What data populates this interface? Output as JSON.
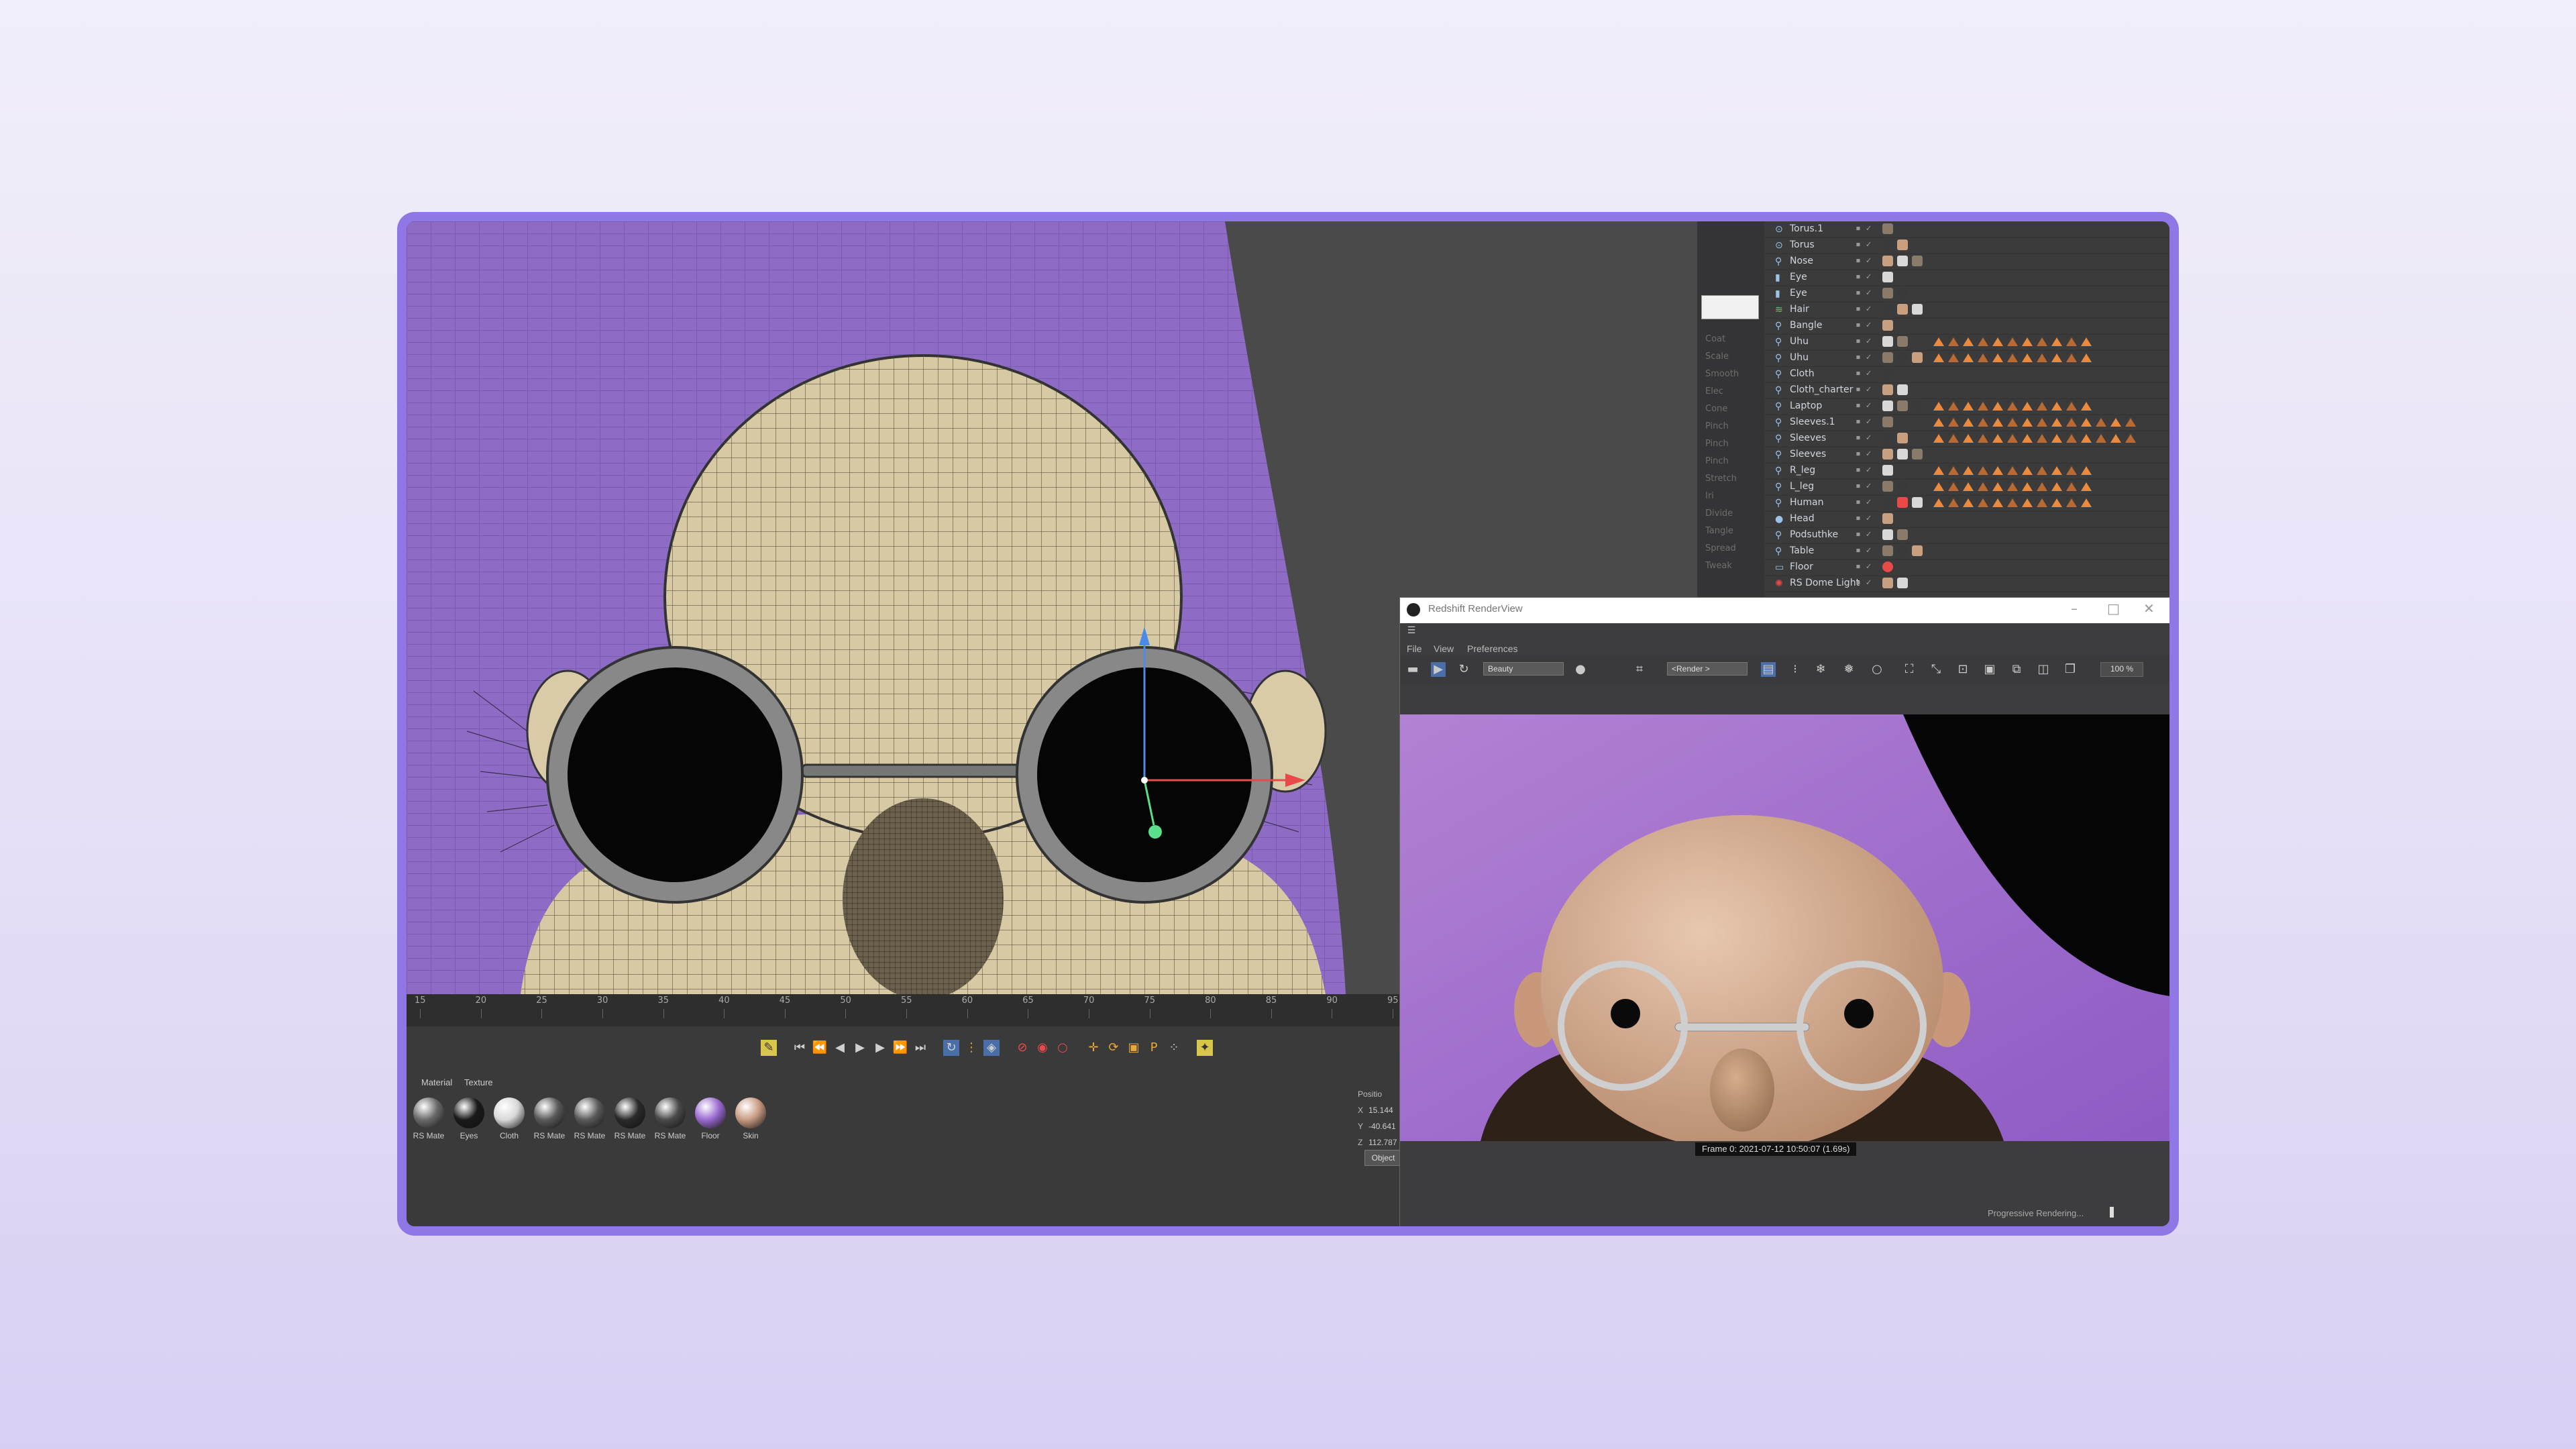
{
  "render_view": {
    "title": "Redshift RenderView",
    "menus": [
      "File",
      "View",
      "Preferences"
    ],
    "aov_select": "Beauty",
    "camera_select": "<Render >",
    "zoom": "100 %",
    "frame_info": "Frame  0:  2021-07-12  10:50:07  (1.69s)",
    "progress_label": "Progressive Rendering..."
  },
  "objects": [
    {
      "name": "Torus.1",
      "icon": "torus"
    },
    {
      "name": "Torus",
      "icon": "torus"
    },
    {
      "name": "Nose",
      "icon": "figure"
    },
    {
      "name": "Eye",
      "icon": "cylinder"
    },
    {
      "name": "Eye",
      "icon": "cylinder"
    },
    {
      "name": "Hair",
      "icon": "hair"
    },
    {
      "name": "Bangle",
      "icon": "figure"
    },
    {
      "name": "Uhu",
      "icon": "figure"
    },
    {
      "name": "Uhu",
      "icon": "figure"
    },
    {
      "name": "Cloth",
      "icon": "figure"
    },
    {
      "name": "Cloth_charter",
      "icon": "figure"
    },
    {
      "name": "Laptop",
      "icon": "figure"
    },
    {
      "name": "Sleeves.1",
      "icon": "figure"
    },
    {
      "name": "Sleeves",
      "icon": "figure"
    },
    {
      "name": "Sleeves",
      "icon": "figure"
    },
    {
      "name": "R_leg",
      "icon": "figure"
    },
    {
      "name": "L_leg",
      "icon": "figure"
    },
    {
      "name": "Human",
      "icon": "figure"
    },
    {
      "name": "Head",
      "icon": "sphere"
    },
    {
      "name": "Podsuthke",
      "icon": "figure"
    },
    {
      "name": "Table",
      "icon": "figure"
    },
    {
      "name": "Floor",
      "icon": "floor"
    },
    {
      "name": "RS Dome Light",
      "icon": "light"
    }
  ],
  "timeline": {
    "ticks": [
      "15",
      "20",
      "25",
      "30",
      "35",
      "40",
      "45",
      "50",
      "55",
      "60",
      "65",
      "70",
      "75",
      "80",
      "85",
      "90",
      "95"
    ]
  },
  "materials": {
    "tabs": [
      "Material",
      "Texture"
    ],
    "items": [
      {
        "label": "RS Mate",
        "color": "#6a6a6a"
      },
      {
        "label": "Eyes",
        "color": "#1a1a1a"
      },
      {
        "label": "Cloth",
        "color": "#d8d8d8"
      },
      {
        "label": "RS Mate",
        "color": "#5a5a5a"
      },
      {
        "label": "RS Mate",
        "color": "#5a5a5a"
      },
      {
        "label": "RS Mate",
        "color": "#2a2a2a"
      },
      {
        "label": "RS Mate",
        "color": "#4a4a4a"
      },
      {
        "label": "Floor",
        "color": "#9a6ad0"
      },
      {
        "label": "Skin",
        "color": "#c89a82"
      }
    ]
  },
  "coordinates": {
    "header": "Positio",
    "x_label": "X",
    "x_value": "15.144",
    "y_label": "Y",
    "y_value": "-40.641",
    "z_label": "Z",
    "z_value": "112.787",
    "object_button": "Object"
  },
  "attribute_items": [
    "Coat",
    "Scale",
    "Smooth",
    "Elec",
    "Cone",
    "Pinch",
    "Pinch",
    "Pinch",
    "Stretch",
    "Iri",
    "Divide",
    "Tangle",
    "Spread",
    "Tweak"
  ]
}
